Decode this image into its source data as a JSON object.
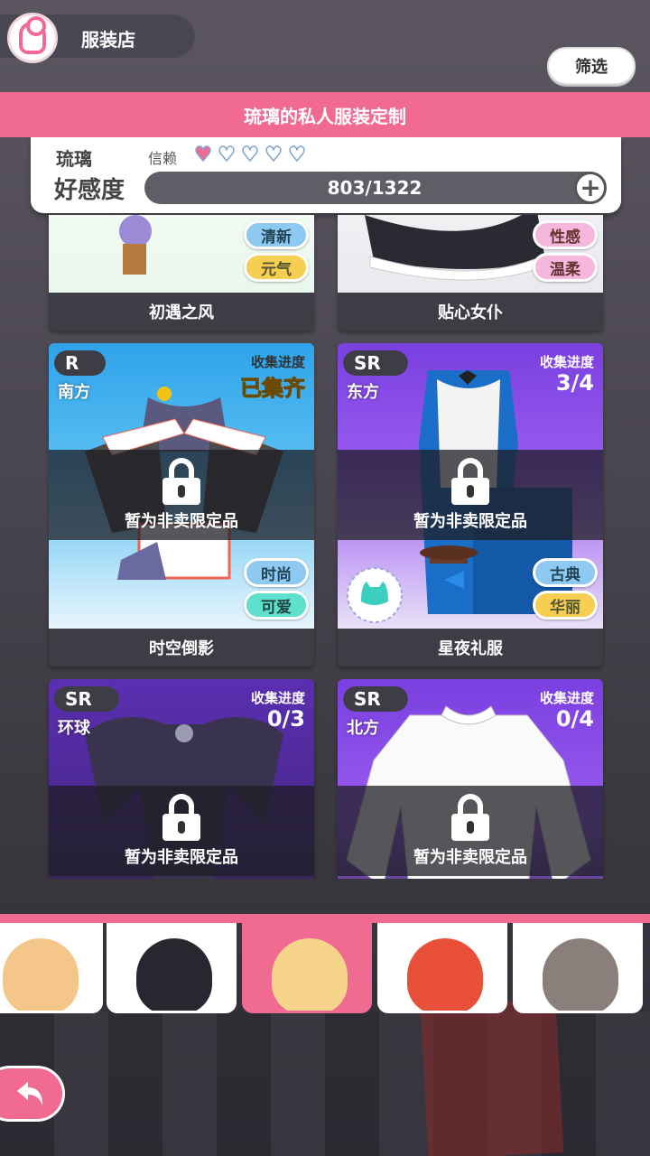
{
  "shop": {
    "title": "服装店",
    "logo_icon": "dress-logo-icon"
  },
  "filter": {
    "label": "筛选"
  },
  "banner": {
    "title": "琉璃的私人服装定制"
  },
  "status": {
    "character": "琉璃",
    "trust_label": "信赖",
    "trust_level": 0.5,
    "trust_max": 5,
    "affinity_label": "好感度",
    "affinity_value": "803/1322"
  },
  "outfits": [
    {
      "name": "初遇之风",
      "tags": [
        "清新",
        "元气"
      ],
      "icon": "star-badge-icon"
    },
    {
      "name": "贴心女仆",
      "tags": [
        "性感",
        "温柔"
      ],
      "icon": "hood-icon"
    },
    {
      "name": "时空倒影",
      "rarity": "R",
      "origin": "南方",
      "progress_label": "收集进度",
      "progress": "已集齐",
      "locked_text": "暂为非卖限定品",
      "tags": [
        "时尚",
        "可爱"
      ],
      "icon": "jacket-icon"
    },
    {
      "name": "星夜礼服",
      "rarity": "SR",
      "origin": "东方",
      "progress_label": "收集进度",
      "progress": "3/4",
      "locked_text": "暂为非卖限定品",
      "tags": [
        "古典",
        "华丽"
      ],
      "icon": "top-hat-icon"
    },
    {
      "name": "",
      "rarity": "SR",
      "origin": "环球",
      "progress_label": "收集进度",
      "progress": "0/3",
      "locked_text": "暂为非卖限定品"
    },
    {
      "name": "",
      "rarity": "SR",
      "origin": "北方",
      "progress_label": "收集进度",
      "progress": "0/4",
      "locked_text": "暂为非卖限定品"
    }
  ],
  "colors": {
    "accent": "#f06a92",
    "card_dark": "#3d3d45",
    "sr_purple": "#8a4fe8",
    "r_blue": "#4fb6ee"
  }
}
